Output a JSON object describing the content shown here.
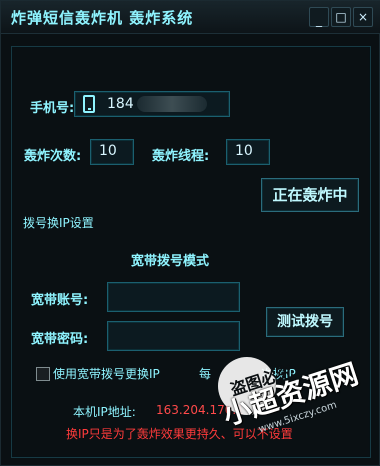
{
  "window": {
    "title": "炸弹短信轰炸机  轰炸系统",
    "controls": {
      "minimize_label": "_",
      "maximize_label": "□",
      "close_label": "×"
    }
  },
  "form": {
    "phone_label": "手机号:",
    "phone_value": "184",
    "count_label": "轰炸次数:",
    "count_value": "10",
    "threads_label": "轰炸线程:",
    "threads_value": "10",
    "bomb_button_label": "正在轰炸中",
    "dial_ip_settings_label": "拨号换IP设置",
    "broadband_mode_label": "宽带拨号模式",
    "account_label": "宽带账号:",
    "account_value": "",
    "password_label": "宽带密码:",
    "password_value": "",
    "test_dial_button_label": "测试拨号",
    "use_broadband_checkbox_label": "使用宽带拨号更换IP",
    "every_label": "每",
    "change_ip_label": "次换IP",
    "local_ip_label": "本机IP地址:",
    "local_ip_value": "163.204.170.1",
    "warning_text": "换IP只是为了轰炸效果更持久、可以不设置"
  },
  "watermark": {
    "top_text": "盗图必究",
    "main_text": "小超资源网",
    "url": "www.5ixczy.com"
  },
  "colors": {
    "accent": "#8ff4ff",
    "warning": "#ff3b3b",
    "background": "#0a1013"
  }
}
